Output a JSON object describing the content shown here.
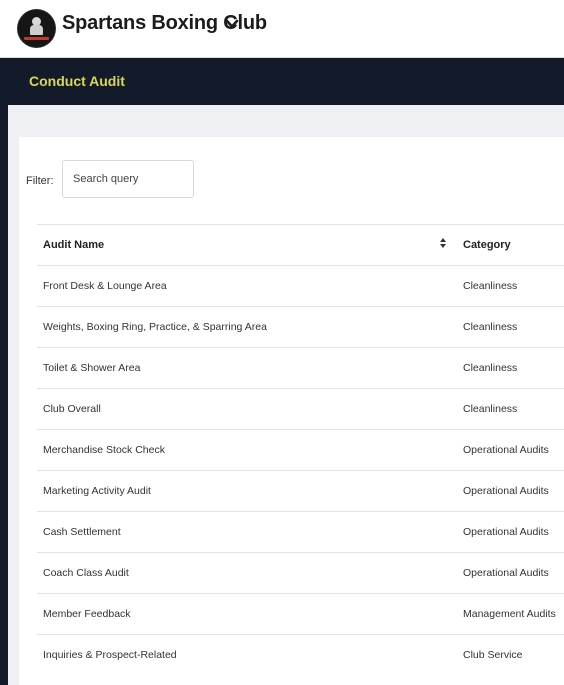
{
  "club": {
    "name": "Spartans Boxing Club"
  },
  "header": {
    "title": "Conduct Audit"
  },
  "filter": {
    "label": "Filter:",
    "placeholder": "Search query"
  },
  "table": {
    "columns": [
      "Audit Name",
      "Category"
    ],
    "rows": [
      {
        "name": "Front Desk & Lounge Area",
        "category": "Cleanliness"
      },
      {
        "name": "Weights, Boxing Ring, Practice, & Sparring Area",
        "category": "Cleanliness"
      },
      {
        "name": "Toilet & Shower Area",
        "category": "Cleanliness"
      },
      {
        "name": "Club Overall",
        "category": "Cleanliness"
      },
      {
        "name": "Merchandise Stock Check",
        "category": "Operational Audits"
      },
      {
        "name": "Marketing Activity Audit",
        "category": "Operational Audits"
      },
      {
        "name": "Cash Settlement",
        "category": "Operational Audits"
      },
      {
        "name": "Coach Class Audit",
        "category": "Operational Audits"
      },
      {
        "name": "Member Feedback",
        "category": "Management Audits"
      },
      {
        "name": "Inquiries & Prospect-Related",
        "category": "Club Service"
      }
    ]
  },
  "icons": {
    "logo": "club-logo",
    "dropdown": "chevron-down-icon",
    "sort": "sort-icon"
  },
  "colors": {
    "header_bg": "#131b2a",
    "header_title": "#d9d65a",
    "content_bg": "#eef0f3"
  }
}
